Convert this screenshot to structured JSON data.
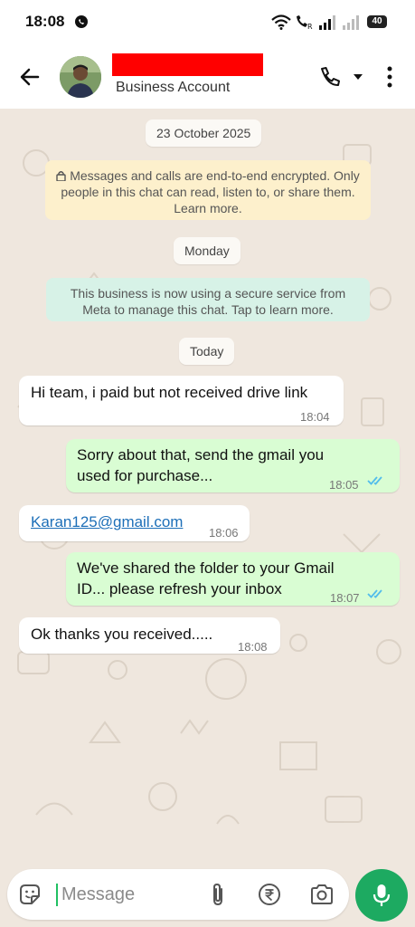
{
  "status_bar": {
    "time": "18:08",
    "battery": "40"
  },
  "header": {
    "contact_subtitle": "Business Account"
  },
  "chat": {
    "date_chip": "23 October 2025",
    "encryption_notice": "Messages and calls are end-to-end encrypted. Only people in this chat can read, listen to, or share them. Learn more.",
    "day_chip": "Monday",
    "business_notice": "This business is now using a secure service from Meta to manage this chat. Tap to learn more.",
    "today_chip": "Today",
    "messages": [
      {
        "direction": "incoming",
        "text": "Hi team, i paid but not received drive link",
        "time": "18:04"
      },
      {
        "direction": "outgoing",
        "text": "Sorry about that, send the gmail you used for purchase...",
        "time": "18:05",
        "status": "read"
      },
      {
        "direction": "incoming",
        "text": "Karan125@gmail.com",
        "time": "18:06",
        "is_link": true
      },
      {
        "direction": "outgoing",
        "text": "We've shared the folder to your Gmail ID... please refresh your inbox",
        "time": "18:07",
        "status": "read"
      },
      {
        "direction": "incoming",
        "text": "Ok thanks you received.....",
        "time": "18:08"
      }
    ]
  },
  "composer": {
    "placeholder": "Message"
  },
  "colors": {
    "accent_green": "#1daa61",
    "outgoing_bubble": "#d9fdd3",
    "read_ticks": "#53bdeb",
    "chat_background": "#efe7de"
  },
  "icons": [
    "back-arrow-icon",
    "phone-icon",
    "chevron-down-icon",
    "more-vertical-icon",
    "lock-icon",
    "double-check-icon",
    "sticker-icon",
    "paperclip-icon",
    "rupee-icon",
    "camera-icon",
    "microphone-icon"
  ]
}
